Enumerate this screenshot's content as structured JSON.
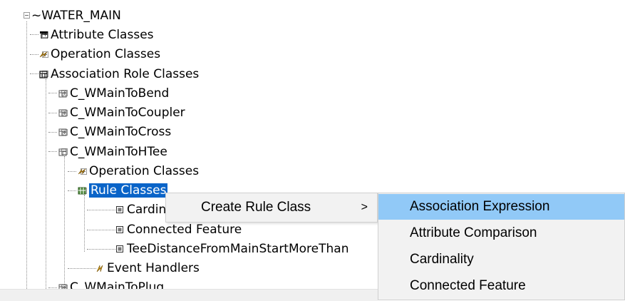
{
  "tree": {
    "root": "~WATER_MAIN",
    "attribute_classes": "Attribute Classes",
    "operation_classes": "Operation Classes",
    "association_role_classes": "Association Role Classes",
    "bend": "C_WMainToBend",
    "coupler": "C_WMainToCoupler",
    "cross": "C_WMainToCross",
    "htee": "C_WMainToHTee",
    "htee_operation_classes": "Operation Classes",
    "rule_classes": "Rule Classes",
    "cardinality_rule": "Cardinality",
    "connected_feature_rule": "Connected Feature",
    "tee_distance_rule": "TeeDistanceFromMainStartMoreThan",
    "event_handlers": "Event Handlers",
    "plug": "C_WMainToPlug"
  },
  "context_menu": {
    "create_rule_class": "Create Rule Class",
    "submenu_arrow": ">"
  },
  "submenu": {
    "items": [
      "Association Expression",
      "Attribute Comparison",
      "Cardinality",
      "Connected Feature"
    ]
  }
}
